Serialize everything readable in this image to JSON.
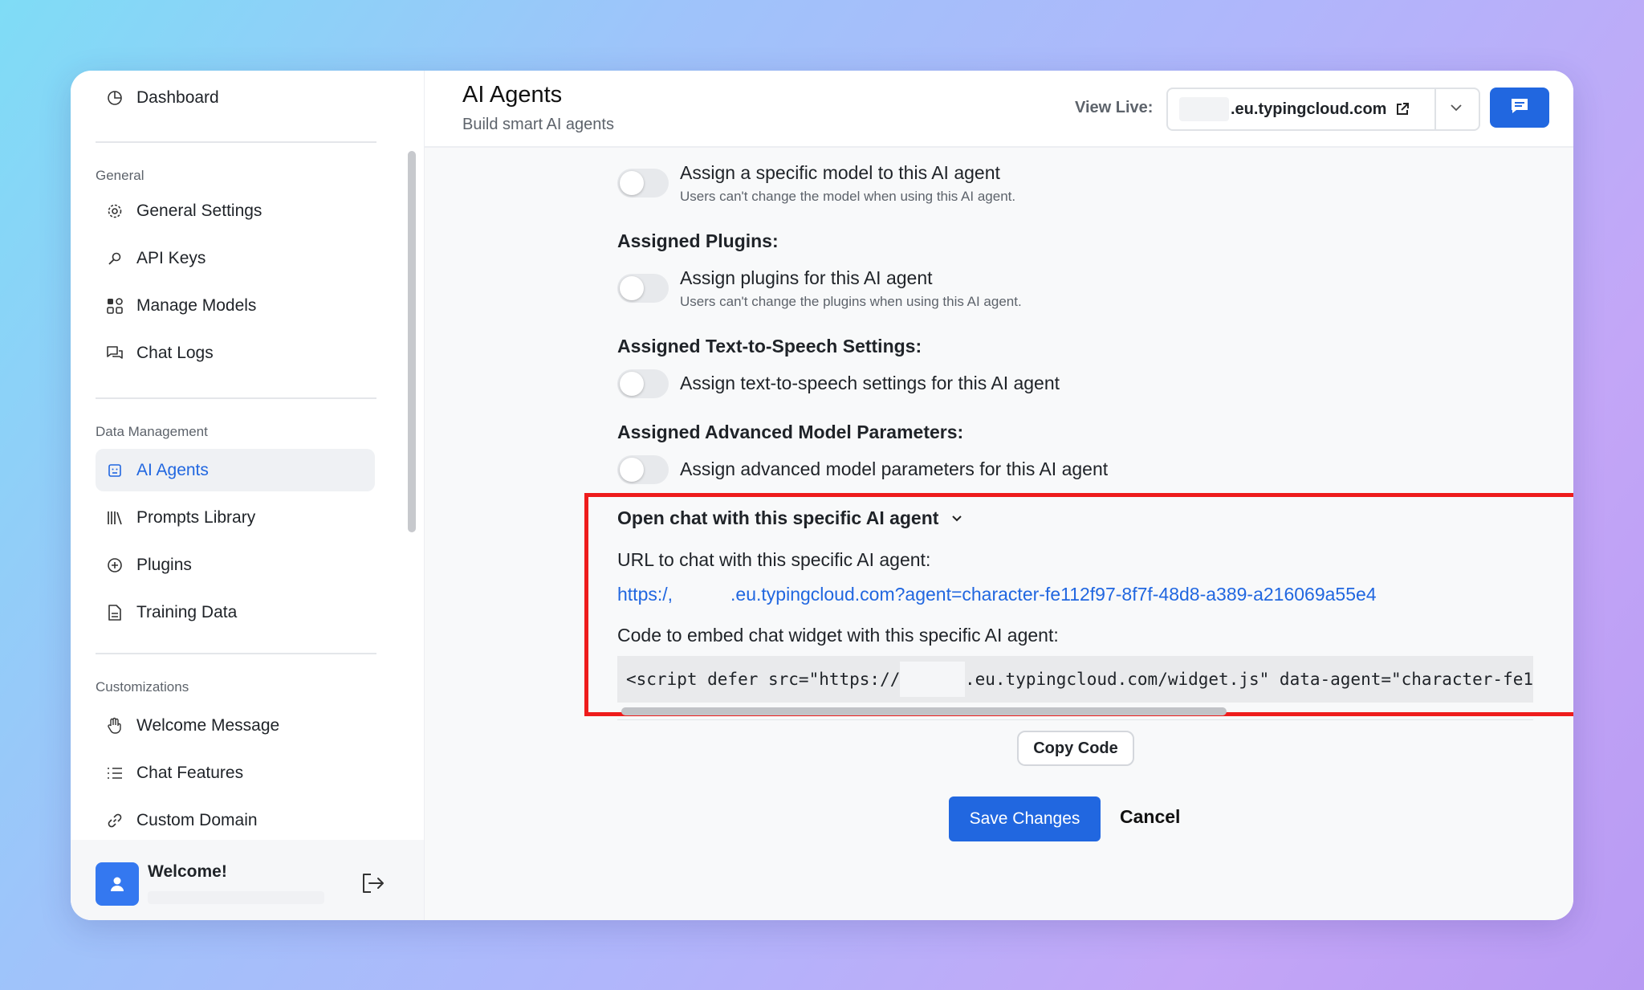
{
  "sidebar": {
    "top_item": {
      "label": "Dashboard",
      "icon": "pie-chart-icon"
    },
    "sections": [
      {
        "label": "General"
      },
      {
        "label": "Data Management"
      },
      {
        "label": "Customizations"
      }
    ],
    "general_items": [
      {
        "label": "General Settings",
        "icon": "gear-icon"
      },
      {
        "label": "API Keys",
        "icon": "key-icon"
      },
      {
        "label": "Manage Models",
        "icon": "grid-icon"
      },
      {
        "label": "Chat Logs",
        "icon": "chat-bubbles-icon"
      }
    ],
    "data_items": [
      {
        "label": "AI Agents",
        "icon": "robot-icon",
        "active": true
      },
      {
        "label": "Prompts Library",
        "icon": "books-icon"
      },
      {
        "label": "Plugins",
        "icon": "plus-circle-icon"
      },
      {
        "label": "Training Data",
        "icon": "document-icon"
      }
    ],
    "custom_items": [
      {
        "label": "Welcome Message",
        "icon": "hand-icon"
      },
      {
        "label": "Chat Features",
        "icon": "list-icon"
      },
      {
        "label": "Custom Domain",
        "icon": "link-icon"
      }
    ],
    "user": {
      "welcome": "Welcome!"
    }
  },
  "header": {
    "title": "AI Agents",
    "subtitle": "Build smart AI agents",
    "view_live_label": "View Live:",
    "view_live_url": ".eu.typingcloud.com"
  },
  "options": {
    "model": {
      "label": "Assign a specific model to this AI agent",
      "desc": "Users can't change the model when using this AI agent.",
      "enabled": false
    },
    "plugins_heading": "Assigned Plugins:",
    "plugins": {
      "label": "Assign plugins for this AI agent",
      "desc": "Users can't change the plugins when using this AI agent.",
      "enabled": false
    },
    "tts_heading": "Assigned Text-to-Speech Settings:",
    "tts": {
      "label": "Assign text-to-speech settings for this AI agent",
      "enabled": false
    },
    "adv_heading": "Assigned Advanced Model Parameters:",
    "adv": {
      "label": "Assign advanced model parameters for this AI agent",
      "enabled": false
    }
  },
  "open_chat": {
    "heading": "Open chat with this specific AI agent",
    "url_label": "URL to chat with this specific AI agent:",
    "url_prefix": "https:/,",
    "url_suffix": ".eu.typingcloud.com?agent=character-fe112f97-8f7f-48d8-a389-a216069a55e4",
    "code_label": "Code to embed chat widget with this specific AI agent:",
    "code_prefix": "<script defer src=\"https://",
    "code_suffix": ".eu.typingcloud.com/widget.js\" data-agent=\"character-fe1",
    "copy_label": "Copy Code"
  },
  "actions": {
    "save": "Save Changes",
    "cancel": "Cancel"
  },
  "colors": {
    "accent": "#2167e0",
    "highlight": "#ee1c1c"
  }
}
